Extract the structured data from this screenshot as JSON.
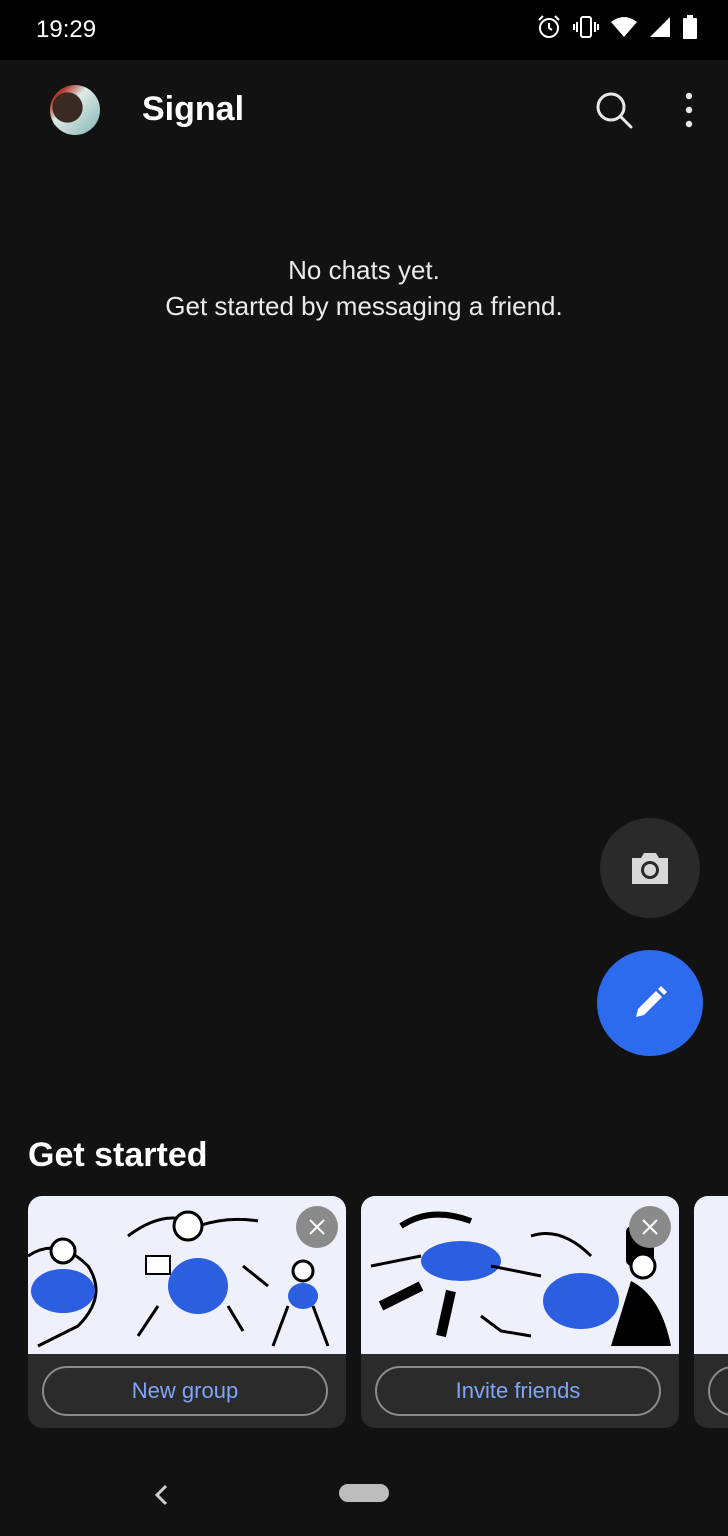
{
  "status_bar": {
    "time": "19:29",
    "icons": [
      "alarm-icon",
      "vibrate-icon",
      "wifi-icon",
      "signal-icon",
      "battery-icon"
    ]
  },
  "app_bar": {
    "title": "Signal",
    "avatar": "profile-avatar",
    "actions": [
      "search-icon",
      "more-vert-icon"
    ]
  },
  "empty_state": {
    "line1": "No chats yet.",
    "line2": "Get started by messaging a friend."
  },
  "fabs": {
    "camera": "camera-icon",
    "compose": "pencil-icon"
  },
  "get_started": {
    "title": "Get started",
    "cards": [
      {
        "button_label": "New group"
      },
      {
        "button_label": "Invite friends"
      }
    ]
  },
  "colors": {
    "background": "#121212",
    "accent": "#2c6bed",
    "button_text": "#7fa6f6",
    "card_bg": "#2b2b2b",
    "illustration_bg": "#eef0fb"
  }
}
